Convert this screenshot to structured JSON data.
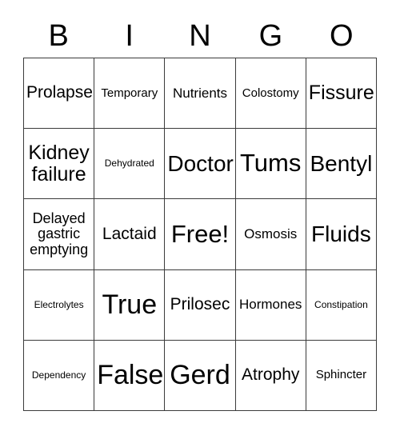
{
  "card": {
    "title": "Bingo Card",
    "background_color": "#ffffff",
    "border_color": "#3b3b3b",
    "text_color": "#000000"
  },
  "header": {
    "letters": [
      {
        "label": "B"
      },
      {
        "label": "I"
      },
      {
        "label": "N"
      },
      {
        "label": "G"
      },
      {
        "label": "O"
      }
    ]
  },
  "grid": {
    "columns": 5,
    "rows": 5,
    "free_space": "Free!",
    "cells": [
      {
        "text": "Prolapse",
        "size": "fs-l",
        "column": "B",
        "row": 1
      },
      {
        "text": "Temporary",
        "size": "fs-s",
        "column": "I",
        "row": 1
      },
      {
        "text": "Nutrients",
        "size": "fs-m",
        "column": "N",
        "row": 1
      },
      {
        "text": "Colostomy",
        "size": "fs-s",
        "column": "G",
        "row": 1
      },
      {
        "text": "Fissure",
        "size": "fs-xl",
        "column": "O",
        "row": 1
      },
      {
        "text": "Kidney\nfailure",
        "size": "fs-xl",
        "column": "B",
        "row": 2
      },
      {
        "text": "Dehydrated",
        "size": "fs-xxs",
        "column": "I",
        "row": 2
      },
      {
        "text": "Doctor",
        "size": "fs-xxl",
        "column": "N",
        "row": 2
      },
      {
        "text": "Tums",
        "size": "fs-3xl",
        "column": "G",
        "row": 2
      },
      {
        "text": "Bentyl",
        "size": "fs-xxl",
        "column": "O",
        "row": 2
      },
      {
        "text": "Delayed\ngastric\nemptying",
        "size": "fs-ml",
        "column": "B",
        "row": 3
      },
      {
        "text": "Lactaid",
        "size": "fs-l",
        "column": "I",
        "row": 3
      },
      {
        "text": "Free!",
        "size": "fs-3xl",
        "column": "N",
        "row": 3
      },
      {
        "text": "Osmosis",
        "size": "fs-m",
        "column": "G",
        "row": 3
      },
      {
        "text": "Fluids",
        "size": "fs-xxl",
        "column": "O",
        "row": 3
      },
      {
        "text": "Electrolytes",
        "size": "fs-xxs",
        "column": "B",
        "row": 4
      },
      {
        "text": "True",
        "size": "fs-4xl",
        "column": "I",
        "row": 4
      },
      {
        "text": "Prilosec",
        "size": "fs-l",
        "column": "N",
        "row": 4
      },
      {
        "text": "Hormones",
        "size": "fs-m",
        "column": "G",
        "row": 4
      },
      {
        "text": "Constipation",
        "size": "fs-xxs",
        "column": "O",
        "row": 4
      },
      {
        "text": "Dependency",
        "size": "fs-xxs",
        "column": "B",
        "row": 5
      },
      {
        "text": "False",
        "size": "fs-4xl",
        "column": "I",
        "row": 5
      },
      {
        "text": "Gerd",
        "size": "fs-4xl",
        "column": "N",
        "row": 5
      },
      {
        "text": "Atrophy",
        "size": "fs-l",
        "column": "G",
        "row": 5
      },
      {
        "text": "Sphincter",
        "size": "fs-s",
        "column": "O",
        "row": 5
      }
    ]
  }
}
